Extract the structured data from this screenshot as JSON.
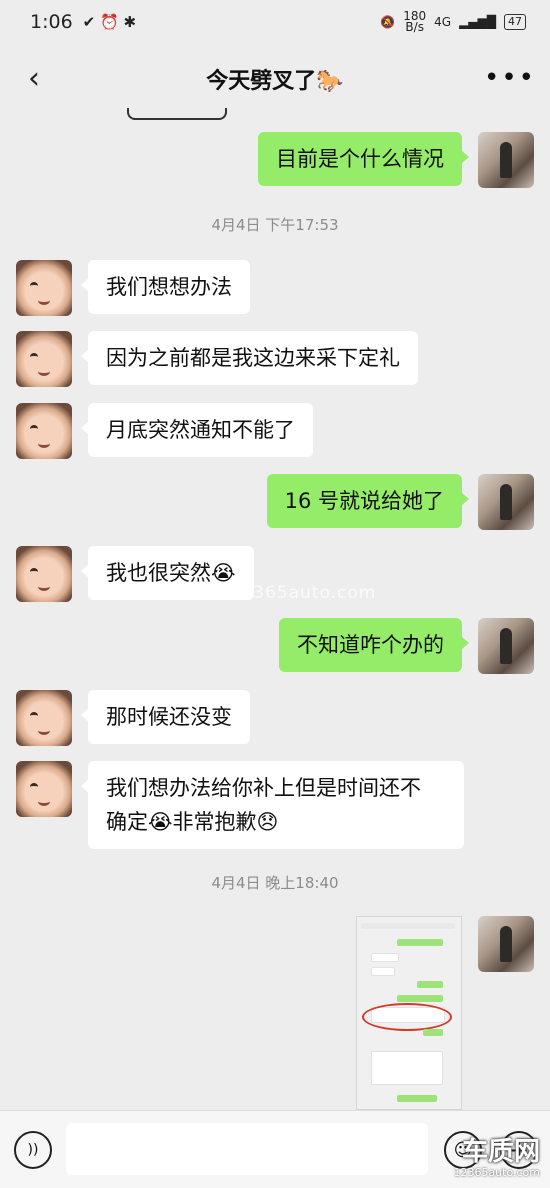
{
  "status_bar": {
    "time": "1:06",
    "net_speed": "180\nB/s",
    "net_speed_top": "180",
    "net_speed_bottom": "B/s",
    "signal": "4G",
    "battery": "47"
  },
  "chat": {
    "title": "今天劈叉了🐎",
    "more": "•••",
    "back": "‹"
  },
  "messages": [
    {
      "side": "right",
      "text": "目前是个什么情况"
    },
    {
      "timestamp": "4月4日 下午17:53"
    },
    {
      "side": "left",
      "text": "我们想想办法"
    },
    {
      "side": "left",
      "text": "因为之前都是我这边来采下定礼"
    },
    {
      "side": "left",
      "text": "月底突然通知不能了"
    },
    {
      "side": "right",
      "text": "16 号就说给她了"
    },
    {
      "side": "left",
      "text": "我也很突然😭"
    },
    {
      "side": "right",
      "text": "不知道咋个办的"
    },
    {
      "side": "left",
      "text": "那时候还没变"
    },
    {
      "side": "left",
      "text_line1": "我们想办法给你补上但是时间还不",
      "text_line2": "确定😭非常抱歉😞"
    },
    {
      "timestamp": "4月4日 晚上18:40"
    }
  ],
  "watermark": "www.12365auto.com",
  "brand": {
    "name": "车质网",
    "url": "12365auto.com"
  },
  "icons": {
    "voice": "voice-icon",
    "emoji": "emoji-icon",
    "plus": "plus-icon"
  }
}
